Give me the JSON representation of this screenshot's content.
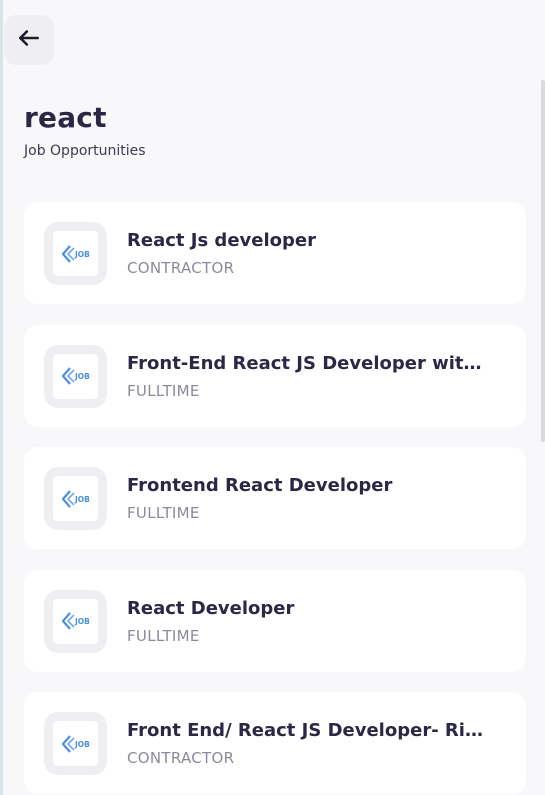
{
  "header": {
    "back_icon": "arrow-left-icon",
    "title": "react",
    "subtitle": "Job Opportunities"
  },
  "jobs": [
    {
      "title": "React Js developer",
      "type": "CONTRACTOR",
      "logo": "job-logo-icon"
    },
    {
      "title": "Front-End React JS Developer with Node",
      "type": "FULLTIME",
      "logo": "job-logo-icon"
    },
    {
      "title": "Frontend React Developer",
      "type": "FULLTIME",
      "logo": "job-logo-icon"
    },
    {
      "title": "React Developer",
      "type": "FULLTIME",
      "logo": "job-logo-icon"
    },
    {
      "title": "Front End/ React JS Developer- Richmond",
      "type": "CONTRACTOR",
      "logo": "job-logo-icon"
    }
  ],
  "colors": {
    "background": "#f8f8fb",
    "text_primary": "#2b2845",
    "text_secondary": "#8b8a9c",
    "logo_blue": "#4a90e2"
  }
}
